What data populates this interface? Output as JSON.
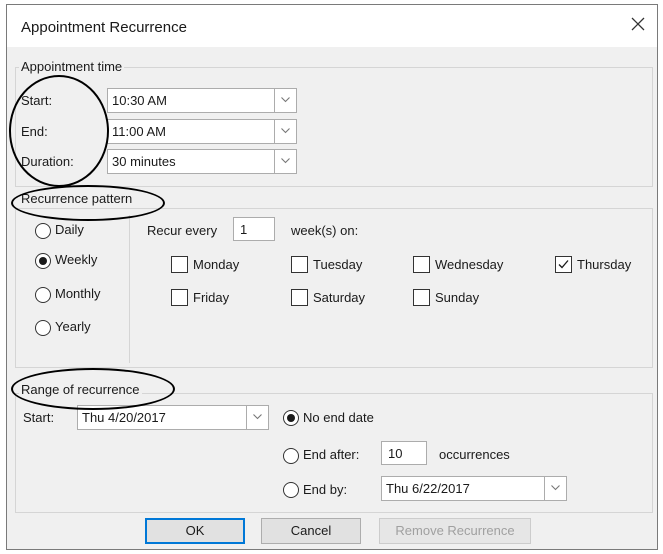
{
  "window": {
    "title": "Appointment Recurrence",
    "close_icon": "close-icon"
  },
  "appointment_time": {
    "legend": "Appointment time",
    "start_label": "Start:",
    "start_value": "10:30 AM",
    "end_label": "End:",
    "end_value": "11:00 AM",
    "duration_label": "Duration:",
    "duration_value": "30 minutes"
  },
  "recurrence_pattern": {
    "legend": "Recurrence pattern",
    "options": [
      {
        "label": "Daily",
        "selected": false
      },
      {
        "label": "Weekly",
        "selected": true
      },
      {
        "label": "Monthly",
        "selected": false
      },
      {
        "label": "Yearly",
        "selected": false
      }
    ],
    "recur_every_label": "Recur every",
    "recur_every_value": "1",
    "weeks_on_label": "week(s) on:",
    "days": [
      {
        "label": "Monday",
        "checked": false
      },
      {
        "label": "Tuesday",
        "checked": false
      },
      {
        "label": "Wednesday",
        "checked": false
      },
      {
        "label": "Thursday",
        "checked": true
      },
      {
        "label": "Friday",
        "checked": false
      },
      {
        "label": "Saturday",
        "checked": false
      },
      {
        "label": "Sunday",
        "checked": false
      }
    ]
  },
  "range": {
    "legend": "Range of recurrence",
    "start_label": "Start:",
    "start_value": "Thu 4/20/2017",
    "no_end_label": "No end date",
    "end_after_label": "End after:",
    "end_after_value": "10",
    "occurrences_label": "occurrences",
    "end_by_label": "End by:",
    "end_by_value": "Thu 6/22/2017",
    "selected": "no_end"
  },
  "buttons": {
    "ok": "OK",
    "cancel": "Cancel",
    "remove": "Remove Recurrence"
  },
  "colors": {
    "dialog_bg": "#f0f0f0",
    "accent": "#0078d7",
    "disabled_text": "#a0a0a0"
  }
}
